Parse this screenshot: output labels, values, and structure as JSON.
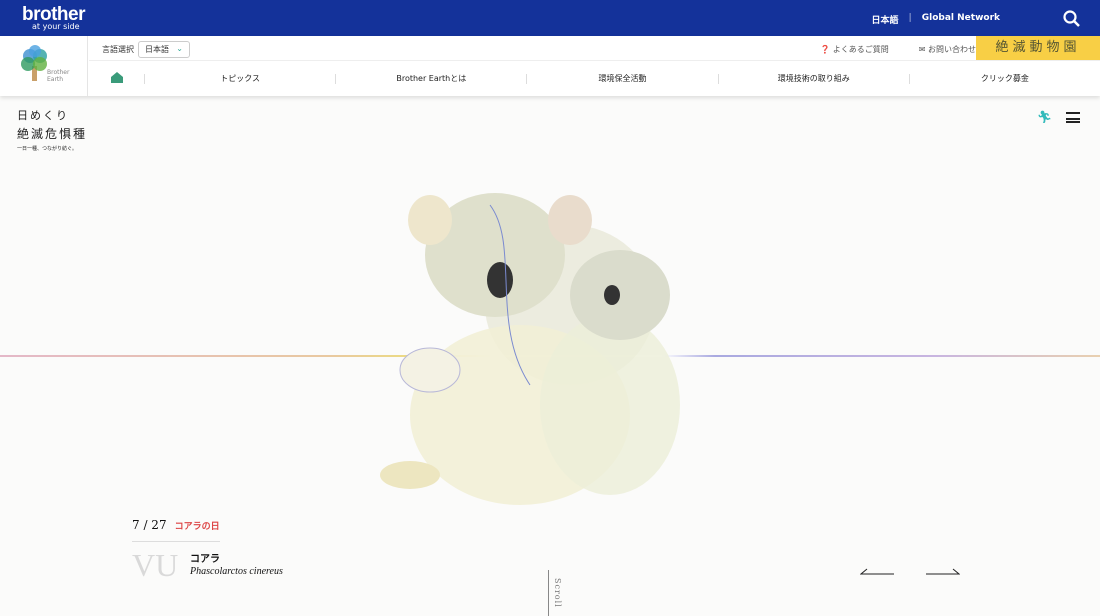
{
  "topbar": {
    "logo": "brother",
    "tagline": "at your side",
    "lang": "日本語",
    "global": "Global Network",
    "icons": {
      "search": "search-icon"
    }
  },
  "header": {
    "earth_logo": "Brother Earth",
    "lang_label": "言語選択",
    "lang_value": "日本語",
    "faq": "よくあるご質問",
    "contact": "お問い合わせ",
    "zoo_banner": "絶滅動物園",
    "nav": [
      "トピックス",
      "Brother Earthとは",
      "環境保全活動",
      "環境技術の取り組み",
      "クリック募金"
    ]
  },
  "page": {
    "brand_line1": "日めくり",
    "brand_line2": "絶滅危惧種",
    "brand_tagline": "一日一種、つながり紡ぐ。",
    "date": "7 / 27",
    "day_name": "コアラの日",
    "status": "VU",
    "name_jp": "コアラ",
    "name_sci": "Phascolarctos cinereus",
    "scroll": "Scroll"
  },
  "colors": {
    "topbar": "#14329a",
    "zoo": "#f8cf45",
    "accent": "#3a9b7a"
  }
}
